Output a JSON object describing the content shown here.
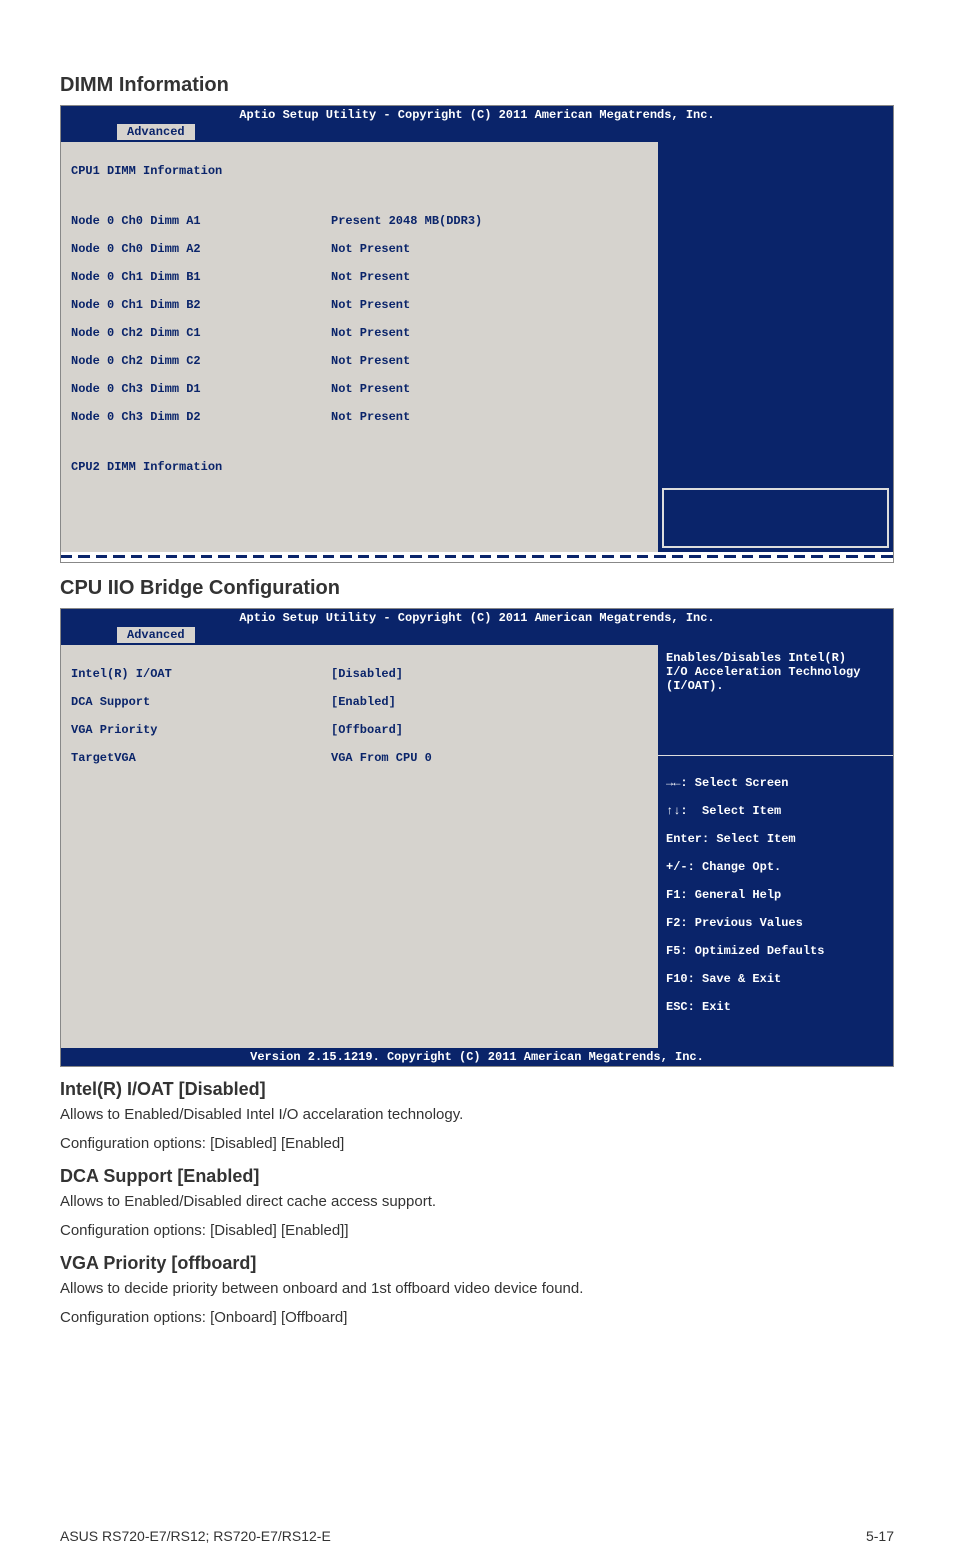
{
  "section1": {
    "heading": "DIMM Information"
  },
  "bios_common": {
    "title": "Aptio Setup Utility - Copyright (C) 2011 American Megatrends, Inc.",
    "tab": "Advanced",
    "version_footer": "Version 2.15.1219. Copyright (C) 2011 American Megatrends, Inc."
  },
  "dimm": {
    "header": "CPU1 DIMM Information",
    "rows": [
      {
        "label": "Node 0 Ch0 Dimm A1",
        "value": "Present 2048 MB(DDR3)"
      },
      {
        "label": "Node 0 Ch0 Dimm A2",
        "value": "Not Present"
      },
      {
        "label": "Node 0 Ch1 Dimm B1",
        "value": "Not Present"
      },
      {
        "label": "Node 0 Ch1 Dimm B2",
        "value": "Not Present"
      },
      {
        "label": "Node 0 Ch2 Dimm C1",
        "value": "Not Present"
      },
      {
        "label": "Node 0 Ch2 Dimm C2",
        "value": "Not Present"
      },
      {
        "label": "Node 0 Ch3 Dimm D1",
        "value": "Not Present"
      },
      {
        "label": "Node 0 Ch3 Dimm D2",
        "value": "Not Present"
      }
    ],
    "footer_line": "CPU2 DIMM Information"
  },
  "section2": {
    "heading": "CPU IIO Bridge Configuration"
  },
  "iio": {
    "rows": [
      {
        "label": "Intel(R) I/OAT",
        "value": "[Disabled]"
      },
      {
        "label": "DCA Support",
        "value": "[Enabled]"
      },
      {
        "label": "VGA Priority",
        "value": "[Offboard]"
      },
      {
        "label": "TargetVGA",
        "value": "VGA From CPU 0"
      }
    ],
    "help_top": "Enables/Disables Intel(R)\nI/O Acceleration Technology\n(I/OAT).",
    "help_lines": {
      "l1": ": Select Screen",
      "l2": ":  Select Item",
      "l3": "Enter: Select Item",
      "l4": "+/-: Change Opt.",
      "l5": "F1: General Help",
      "l6": "F2: Previous Values",
      "l7": "F5: Optimized Defaults",
      "l8": "F10: Save & Exit",
      "l9": "ESC: Exit"
    }
  },
  "intel_ioat": {
    "heading": "Intel(R) I/OAT [Disabled]",
    "line1": "Allows to Enabled/Disabled Intel I/O accelaration technology.",
    "line2": "Configuration options: [Disabled] [Enabled]"
  },
  "dca": {
    "heading": "DCA Support [Enabled]",
    "line1": "Allows to Enabled/Disabled direct cache access support.",
    "line2": "Configuration options: [Disabled] [Enabled]]"
  },
  "vga": {
    "heading": "VGA Priority [offboard]",
    "line1": "Allows to decide priority between onboard and 1st offboard video device found.",
    "line2": "Configuration options: [Onboard] [Offboard]"
  },
  "page_footer": {
    "left": "ASUS RS720-E7/RS12; RS720-E7/RS12-E",
    "right": "5-17"
  }
}
